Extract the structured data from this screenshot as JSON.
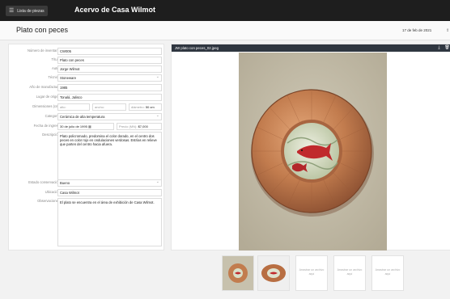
{
  "app": {
    "list_button": "Lista de piezas",
    "title": "Acervo de Casa Wilmot"
  },
  "header": {
    "page_title": "Plato con peces",
    "date": "17 de feb de 2021"
  },
  "form": {
    "inventory_label": "Número de inventario",
    "inventory_value": "CW005",
    "title_label": "Título",
    "title_value": "Plato con peces",
    "author_label": "Autor",
    "author_value": "Jorge Wilmot",
    "technique_label": "Técnica",
    "technique_value": "Stoneware",
    "year_label": "Año de manufactura",
    "year_value": "1985",
    "origin_label": "Lugar de origen",
    "origin_value": "Tonalá, Jalisco",
    "dimensions_label": "Dimensiones (cm)",
    "height_label": "alto:",
    "width_label": "ancho:",
    "diameter_label": "diámetro:",
    "diameter_value": "50 cm",
    "category_label": "Categoría",
    "category_value": "Cerámica de alta temperatura",
    "entry_date_label": "Fecha de ingreso",
    "entry_date_value": "30 de julio de 1995",
    "price_label": "Precio (MN):",
    "price_value": "$7,000",
    "description_label": "Descripción",
    "description_value": "Plato policromado, predomina el color dorado, en el centro dos peces en color rojo en ondulaciones verdosas. Estrías en relieve que parten del centro hacia afuera.",
    "condition_label": "Estado conservación",
    "condition_value": "Bueno",
    "location_label": "Ubicación",
    "location_value": "Casa Wilmot",
    "notes_label": "Observaciones",
    "notes_value": "El plato se encuentra en el área de exhibición de Casa Wilmot."
  },
  "viewer": {
    "filename": "JW plato con peces_02.jpeg",
    "icons": [
      "download-icon",
      "delete-icon"
    ]
  },
  "thumbnails": {
    "placeholder": "Arrastrar un archivo aquí"
  },
  "colors": {
    "topbar": "#1e1e1e",
    "viewer_bar": "#2f3640",
    "copper": "#c27c4e",
    "fish": "#c0292c"
  }
}
